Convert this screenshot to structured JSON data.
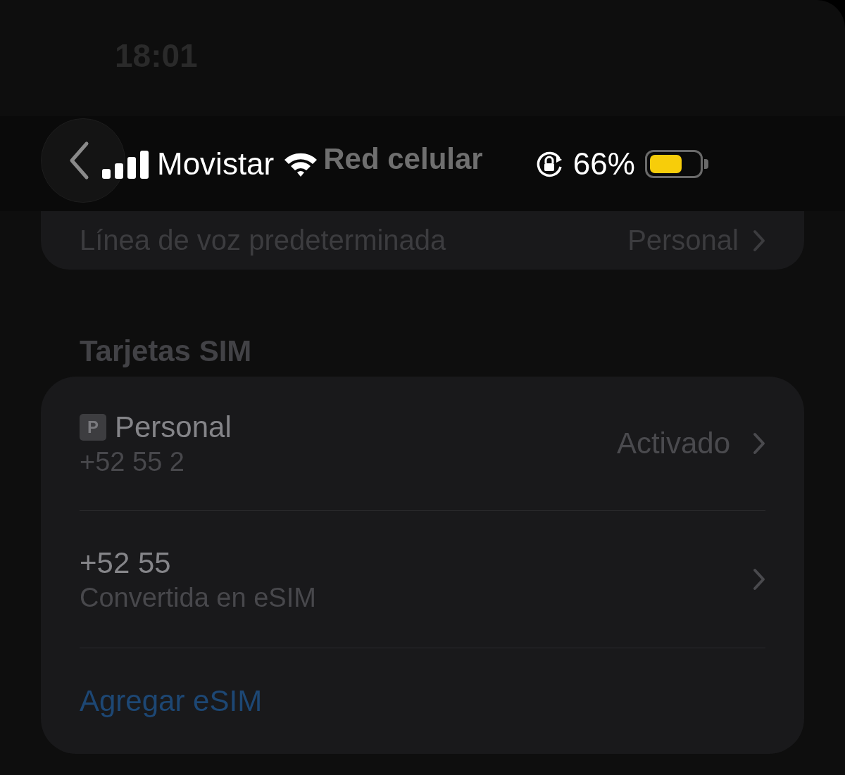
{
  "status_bar": {
    "time": "18:01",
    "carrier": "Movistar",
    "battery_percent": "66%"
  },
  "nav": {
    "title": "Red celular"
  },
  "default_voice_line": {
    "label": "Línea de voz predeterminada",
    "value": "Personal"
  },
  "section_header": "Tarjetas SIM",
  "sim_cards": [
    {
      "badge": "P",
      "name": "Personal",
      "number": "+52 55 2",
      "status": "Activado"
    },
    {
      "name": "+52 55",
      "number": "Convertida en eSIM"
    }
  ],
  "add_esim": "Agregar eSIM"
}
